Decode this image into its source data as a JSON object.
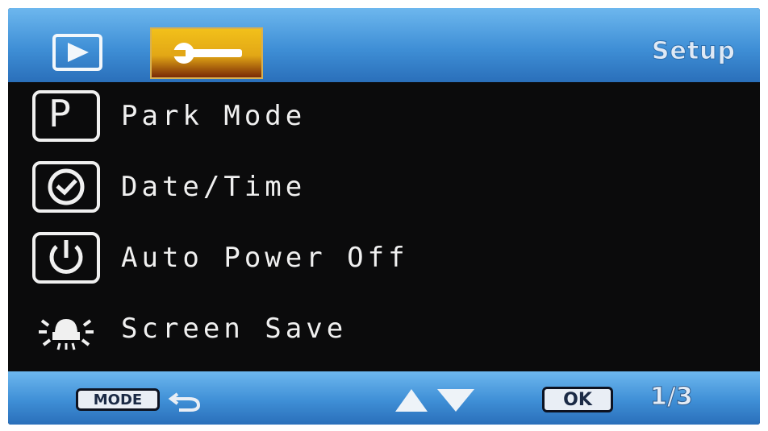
{
  "header": {
    "title": "Setup",
    "tabs": [
      {
        "name": "playback",
        "icon": "play-icon",
        "selected": false
      },
      {
        "name": "setup",
        "icon": "wrench-icon",
        "selected": true
      }
    ]
  },
  "menu": {
    "items": [
      {
        "label": "Park Mode",
        "icon": "park-icon",
        "icon_text": "P"
      },
      {
        "label": "Date/Time",
        "icon": "clock-icon"
      },
      {
        "label": "Auto Power Off",
        "icon": "power-icon"
      },
      {
        "label": "Screen Save",
        "icon": "screen-save-icon"
      }
    ]
  },
  "footer": {
    "mode_label": "MODE",
    "back_icon": "back-arrow-icon",
    "nav_icons": [
      "up-arrow-icon",
      "down-arrow-icon"
    ],
    "ok_label": "OK",
    "page": "1/3"
  },
  "colors": {
    "bar_blue": "#3f8fd6",
    "setup_tab_gold": "#e2a716",
    "background": "#0b0b0c",
    "text": "#f0f0f0"
  }
}
